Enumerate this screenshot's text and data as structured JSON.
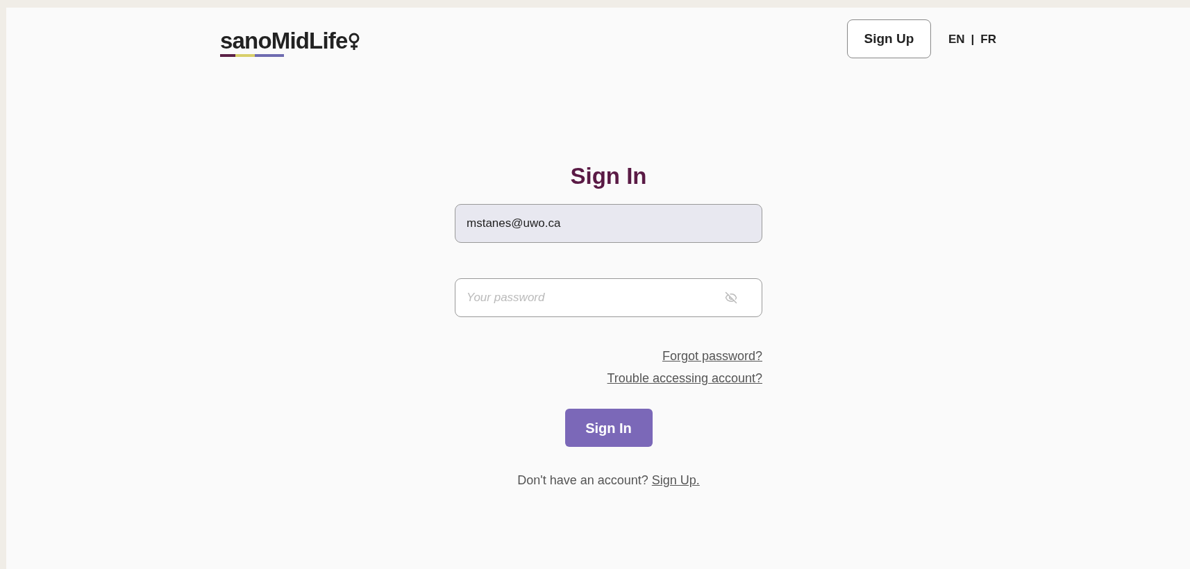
{
  "header": {
    "logo": "sanoMidLife",
    "signup_button": "Sign Up",
    "languages": [
      "EN",
      "FR"
    ],
    "language_separator": "|"
  },
  "form": {
    "title": "Sign In",
    "email": {
      "value": "mstanes@uwo.ca"
    },
    "password": {
      "placeholder": "Your password"
    },
    "links": [
      "Forgot password?",
      "Trouble accessing account?"
    ],
    "submit": "Sign In",
    "footer_text": "Don't have an account?",
    "footer_link": "Sign Up."
  }
}
